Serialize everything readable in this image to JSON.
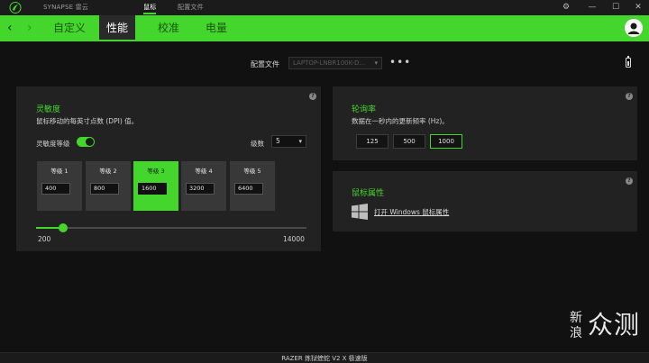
{
  "titlebar": {
    "tabs": [
      {
        "label": "SYNAPSE 雷云"
      },
      {
        "label": "鼠标"
      },
      {
        "label": "配置文件"
      }
    ],
    "controls": {
      "settings": "⚙",
      "minimize": "—",
      "maximize": "☐",
      "close": "✕"
    }
  },
  "nav": {
    "back": "‹",
    "forward": "›",
    "tabs": [
      {
        "label": "自定义"
      },
      {
        "label": "性能"
      },
      {
        "label": "校准"
      },
      {
        "label": "电量"
      }
    ]
  },
  "profile": {
    "label": "配置文件",
    "value": "LAPTOP-LNBR100K-D...",
    "caret": "▾",
    "more": "•••"
  },
  "sensitivity": {
    "title": "灵敏度",
    "desc": "鼠标移动的每英寸点数 (DPI) 值。",
    "help": "?",
    "toggle_label": "灵敏度等级",
    "toggle_on": true,
    "stages_label": "级数",
    "stages_value": "5",
    "stages_caret": "▾",
    "stages": [
      {
        "label": "等级 1",
        "value": "400"
      },
      {
        "label": "等级 2",
        "value": "800"
      },
      {
        "label": "等级 3",
        "value": "1600"
      },
      {
        "label": "等级 4",
        "value": "3200"
      },
      {
        "label": "等级 5",
        "value": "6400"
      }
    ],
    "active_stage": 2,
    "slider_min": "200",
    "slider_max": "14000",
    "slider_value": 1600,
    "slider_range": [
      200,
      14000
    ]
  },
  "polling": {
    "title": "轮询率",
    "desc": "数据在一秒内的更新频率 (Hz)。",
    "help": "?",
    "options": [
      "125",
      "500",
      "1000"
    ],
    "selected": "1000"
  },
  "mouse_props": {
    "title": "鼠标属性",
    "link": "打开 Windows 鼠标属性",
    "help": "?"
  },
  "footer": {
    "device": "RAZER 炼狱蝰蛇 V2 X 极速版"
  },
  "watermark": {
    "small": "新浪",
    "big": "众测"
  },
  "colors": {
    "accent": "#44d62c",
    "background": "#111111",
    "panel": "#222222"
  }
}
